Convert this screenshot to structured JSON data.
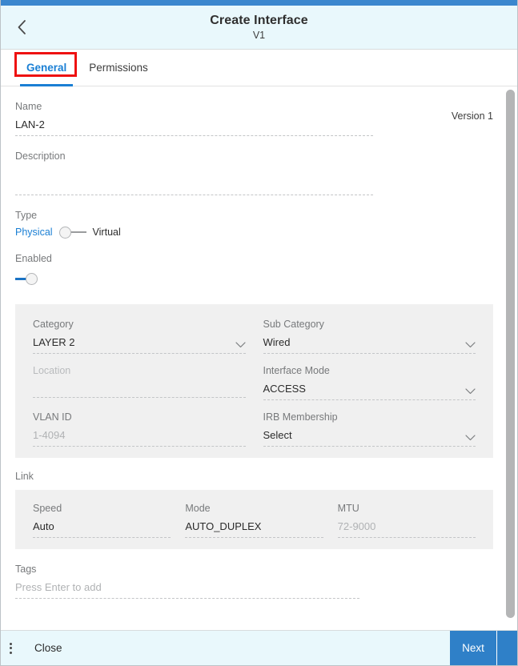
{
  "header": {
    "title": "Create Interface",
    "subtitle": "V1",
    "back_icon": "chevron-left-icon"
  },
  "tabs": [
    {
      "label": "General",
      "active": true
    },
    {
      "label": "Permissions",
      "active": false
    }
  ],
  "form": {
    "name": {
      "label": "Name",
      "value": "LAN-2"
    },
    "version": "Version 1",
    "description": {
      "label": "Description",
      "value": ""
    },
    "type": {
      "label": "Type",
      "option_left": "Physical",
      "option_right": "Virtual",
      "selected": "Physical"
    },
    "enabled": {
      "label": "Enabled",
      "state": "on"
    }
  },
  "category_panel": {
    "category": {
      "label": "Category",
      "value": "LAYER 2"
    },
    "sub_category": {
      "label": "Sub Category",
      "value": "Wired"
    },
    "location": {
      "label": "Location",
      "value": ""
    },
    "interface_mode": {
      "label": "Interface Mode",
      "value": "ACCESS"
    },
    "vlan_id": {
      "label": "VLAN ID",
      "placeholder": "1-4094"
    },
    "irb_membership": {
      "label": "IRB Membership",
      "value": "Select"
    }
  },
  "link": {
    "section_label": "Link",
    "speed": {
      "label": "Speed",
      "value": "Auto"
    },
    "mode": {
      "label": "Mode",
      "value": "AUTO_DUPLEX"
    },
    "mtu": {
      "label": "MTU",
      "placeholder": "72-9000"
    }
  },
  "tags": {
    "label": "Tags",
    "placeholder": "Press Enter to add"
  },
  "footer": {
    "menu_icon": "kebab-menu-icon",
    "close_label": "Close",
    "next_label": "Next",
    "next_menu_icon": "kebab-menu-icon"
  },
  "colors": {
    "accent_blue": "#2f80c8",
    "link_blue": "#1a7fd4",
    "header_bg": "#e9f8fc",
    "panel_bg": "#f0f0f0",
    "highlight_red": "#ee1111"
  }
}
